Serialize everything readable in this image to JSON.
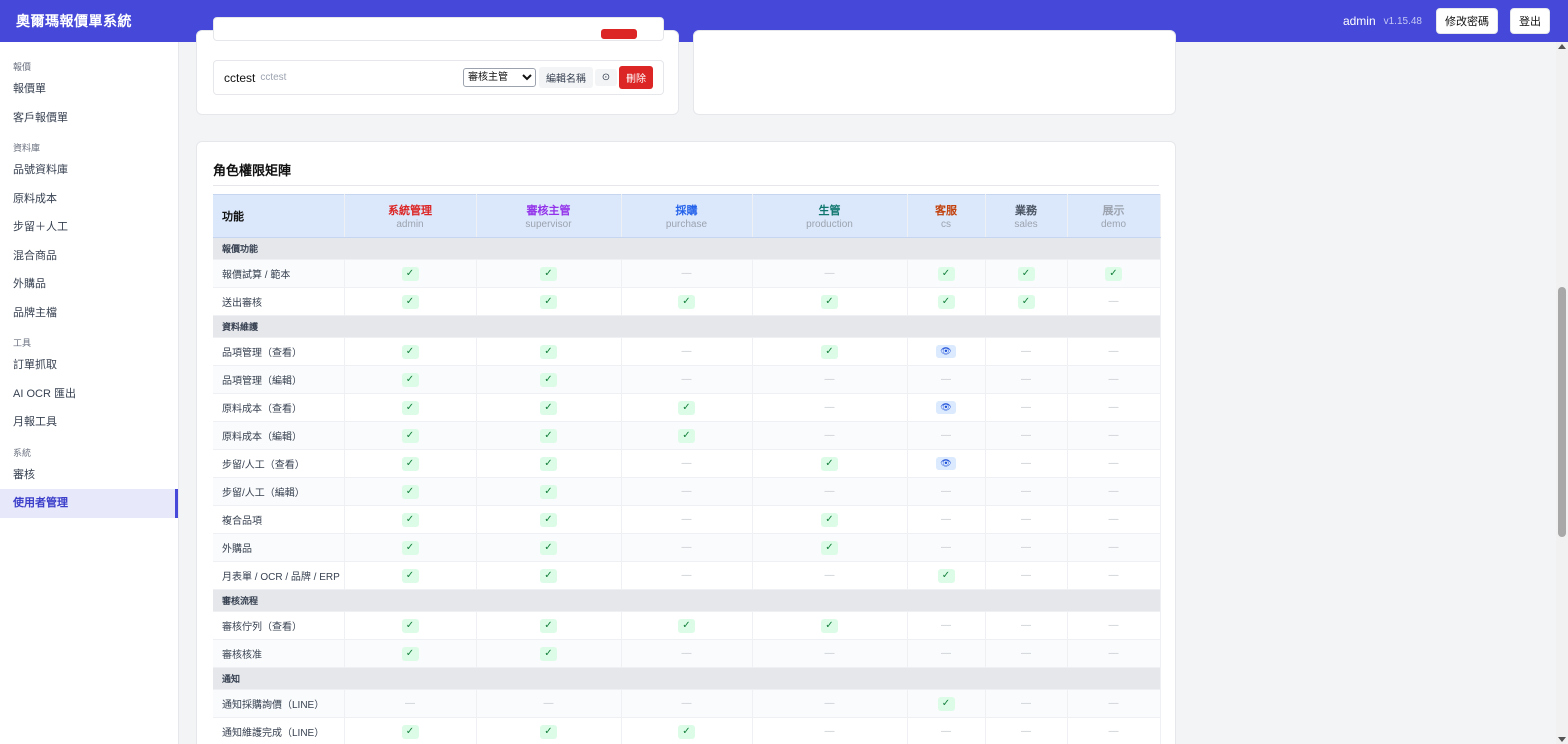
{
  "app": {
    "title": "奧爾瑪報價單系統",
    "user": "admin",
    "version": "v1.15.48",
    "change_password": "修改密碼",
    "logout": "登出"
  },
  "sidebar": {
    "sections": [
      {
        "label": "報價",
        "items": [
          {
            "label": "報價單"
          },
          {
            "label": "客戶報價單"
          }
        ]
      },
      {
        "label": "資料庫",
        "items": [
          {
            "label": "品號資料庫"
          },
          {
            "label": "原料成本"
          },
          {
            "label": "步留＋人工"
          },
          {
            "label": "混合商品"
          },
          {
            "label": "外購品"
          },
          {
            "label": "品牌主檔"
          }
        ]
      },
      {
        "label": "工具",
        "items": [
          {
            "label": "訂單抓取"
          },
          {
            "label": "AI OCR 匯出"
          },
          {
            "label": "月報工具"
          }
        ]
      },
      {
        "label": "系統",
        "items": [
          {
            "label": "審核"
          },
          {
            "label": "使用者管理",
            "active": true
          }
        ]
      }
    ]
  },
  "user_rows": [
    {
      "name": "cctest",
      "id": "cctest",
      "role": "審核主管",
      "role_options": [
        "審核主管"
      ],
      "rename": "編輯名稱",
      "clock_icon": "clock-icon",
      "delete": "刪除"
    }
  ],
  "matrix": {
    "title": "角色權限矩陣",
    "feature_header": "功能",
    "roles": [
      {
        "name": "系統管理",
        "code": "admin",
        "color": "#dc2626"
      },
      {
        "name": "審核主管",
        "code": "supervisor",
        "color": "#9333ea"
      },
      {
        "name": "採購",
        "code": "purchase",
        "color": "#2563eb"
      },
      {
        "name": "生管",
        "code": "production",
        "color": "#0f766e"
      },
      {
        "name": "客服",
        "code": "cs",
        "color": "#c2410c"
      },
      {
        "name": "業務",
        "code": "sales",
        "color": "#4b5563"
      },
      {
        "name": "展示",
        "code": "demo",
        "color": "#9ca3af"
      }
    ],
    "symbols": {
      "yes": "✓",
      "view": "👁",
      "no": "—"
    },
    "categories": [
      {
        "label": "報價功能",
        "rows": [
          {
            "label": "報價試算 / 範本",
            "values": [
              "yes",
              "yes",
              "no",
              "no",
              "yes",
              "yes",
              "yes"
            ]
          },
          {
            "label": "送出審核",
            "values": [
              "yes",
              "yes",
              "yes",
              "yes",
              "yes",
              "yes",
              "no"
            ]
          }
        ]
      },
      {
        "label": "資料維護",
        "rows": [
          {
            "label": "品項管理（查看）",
            "values": [
              "yes",
              "yes",
              "no",
              "yes",
              "view",
              "no",
              "no"
            ]
          },
          {
            "label": "品項管理（編輯）",
            "values": [
              "yes",
              "yes",
              "no",
              "no",
              "no",
              "no",
              "no"
            ]
          },
          {
            "label": "原料成本（查看）",
            "values": [
              "yes",
              "yes",
              "yes",
              "no",
              "view",
              "no",
              "no"
            ]
          },
          {
            "label": "原料成本（編輯）",
            "values": [
              "yes",
              "yes",
              "yes",
              "no",
              "no",
              "no",
              "no"
            ]
          },
          {
            "label": "步留/人工（查看）",
            "values": [
              "yes",
              "yes",
              "no",
              "yes",
              "view",
              "no",
              "no"
            ]
          },
          {
            "label": "步留/人工（編輯）",
            "values": [
              "yes",
              "yes",
              "no",
              "no",
              "no",
              "no",
              "no"
            ]
          },
          {
            "label": "複合品項",
            "values": [
              "yes",
              "yes",
              "no",
              "yes",
              "no",
              "no",
              "no"
            ]
          },
          {
            "label": "外購品",
            "values": [
              "yes",
              "yes",
              "no",
              "yes",
              "no",
              "no",
              "no"
            ]
          },
          {
            "label": "月表單 / OCR / 品牌 / ERP",
            "values": [
              "yes",
              "yes",
              "no",
              "no",
              "yes",
              "no",
              "no"
            ]
          }
        ]
      },
      {
        "label": "審核流程",
        "rows": [
          {
            "label": "審核佇列（查看）",
            "values": [
              "yes",
              "yes",
              "yes",
              "yes",
              "no",
              "no",
              "no"
            ]
          },
          {
            "label": "審核核准",
            "values": [
              "yes",
              "yes",
              "no",
              "no",
              "no",
              "no",
              "no"
            ]
          }
        ]
      },
      {
        "label": "通知",
        "rows": [
          {
            "label": "通知採購詢價（LINE）",
            "values": [
              "no",
              "no",
              "no",
              "no",
              "yes",
              "no",
              "no"
            ]
          },
          {
            "label": "通知維護完成（LINE）",
            "values": [
              "yes",
              "yes",
              "yes",
              "no",
              "no",
              "no",
              "no"
            ]
          }
        ]
      }
    ]
  }
}
